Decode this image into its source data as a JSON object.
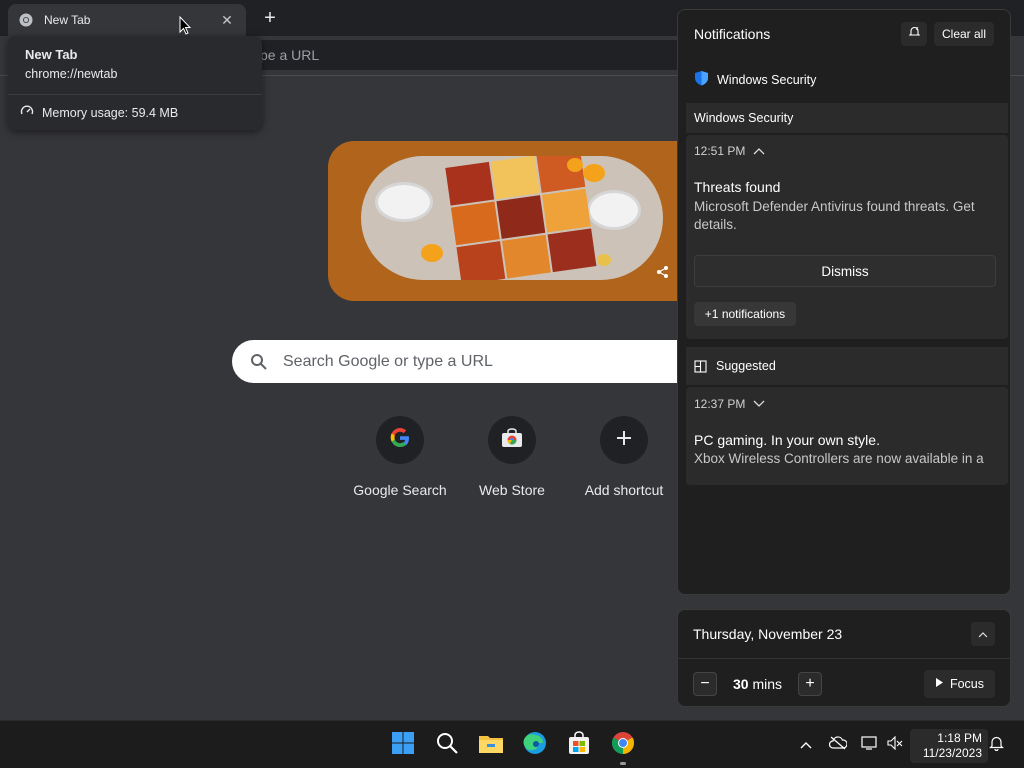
{
  "browser": {
    "tab": {
      "title": "New Tab"
    },
    "omnibox_partial": "pe a URL",
    "hovercard": {
      "title": "New Tab",
      "url": "chrome://newtab",
      "memory": "Memory usage: 59.4 MB"
    }
  },
  "newtab": {
    "search_placeholder": "Search Google or type a URL",
    "shortcuts": [
      {
        "label": "Google Search",
        "icon": "google-icon"
      },
      {
        "label": "Web Store",
        "icon": "web-store-icon"
      },
      {
        "label": "Add shortcut",
        "icon": "plus-icon"
      }
    ]
  },
  "notifications": {
    "header": "Notifications",
    "clear_all": "Clear all",
    "app_name": "Windows Security",
    "group1": {
      "group_title": "Windows Security",
      "time": "12:51 PM",
      "title": "Threats found",
      "body": "Microsoft Defender Antivirus found threats. Get details.",
      "dismiss": "Dismiss",
      "more": "+1 notifications"
    },
    "group2": {
      "group_title": "Suggested",
      "time": "12:37 PM",
      "title": "PC gaming. In your own style.",
      "body": "Xbox Wireless Controllers are now available in a"
    }
  },
  "calendar": {
    "date": "Thursday, November 23",
    "focus_value": "30",
    "focus_unit": "mins",
    "focus_label": "Focus"
  },
  "taskbar": {
    "time": "1:18 PM",
    "date": "11/23/2023"
  },
  "colors": {
    "chrome_bg": "#35363a",
    "doodle_bg": "#b1641b",
    "panel_bg": "#1f1f1f",
    "accent_blue": "#1a73e8"
  }
}
